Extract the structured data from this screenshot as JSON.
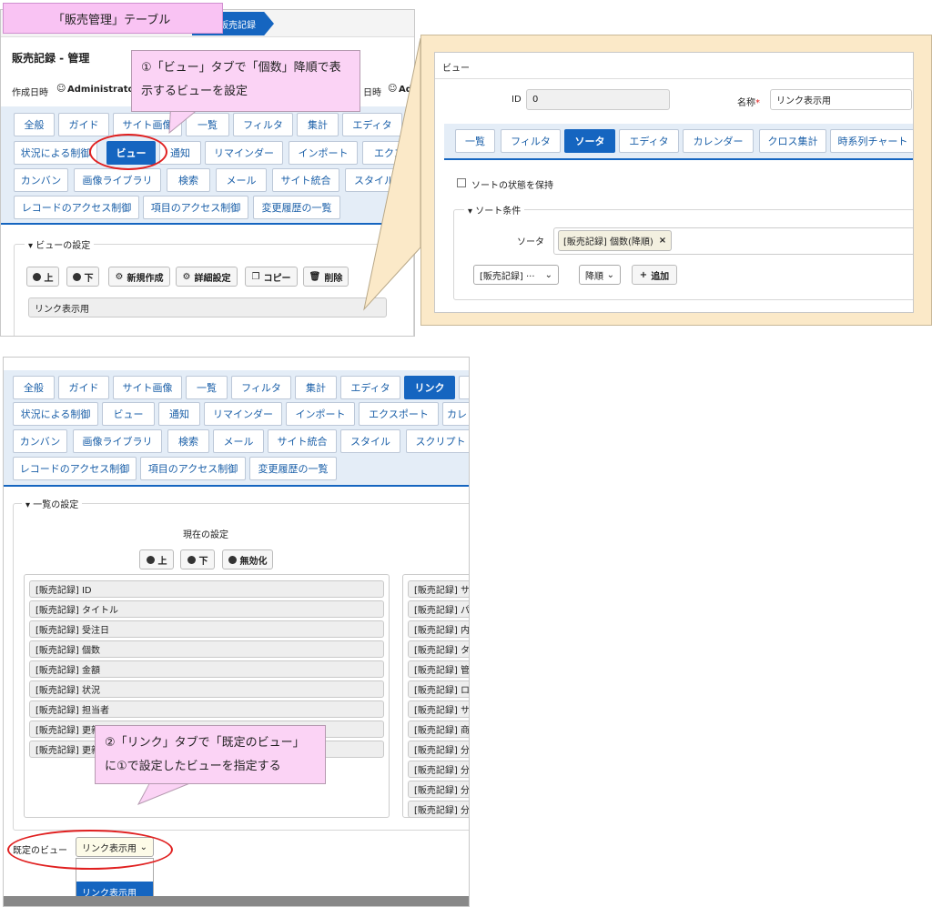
{
  "top_left": {
    "title_label": "「販売管理」テーブル",
    "breadcrumb_current": "販売記録",
    "page_title": "販売記録 - 管理",
    "created_label": "作成日時",
    "created_user": "Administrato",
    "updated_label": "日時",
    "updated_user": "Adı",
    "tabs": [
      "全般",
      "ガイド",
      "サイト画像",
      "一覧",
      "フィルタ",
      "集計",
      "エディタ",
      "状況による制御",
      "ビュー",
      "通知",
      "リマインダー",
      "インポート",
      "エクスポー",
      "カンバン",
      "画像ライブラリ",
      "検索",
      "メール",
      "サイト統合",
      "スタイル",
      "レコードのアクセス制御",
      "項目のアクセス制御",
      "変更履歴の一覧"
    ],
    "view_settings_legend": "ビューの設定",
    "buttons": [
      "上",
      "下",
      "新規作成",
      "詳細設定",
      "コピー",
      "削除"
    ],
    "view_item": "リンク表示用",
    "callout": "①「ビュー」タブで「個数」降順で表示するビューを設定"
  },
  "view_dialog": {
    "title": "ビュー",
    "id_label": "ID",
    "id_value": "0",
    "name_label": "名称",
    "required_mark": "*",
    "name_value": "リンク表示用",
    "tabs": [
      "一覧",
      "フィルタ",
      "ソータ",
      "エディタ",
      "カレンダー",
      "クロス集計",
      "時系列チャート"
    ],
    "keep_sort_label": "ソートの状態を保持",
    "sort_legend": "ソート条件",
    "sorter_label": "ソータ",
    "sorter_chip": "[販売記録] 個数(降順)",
    "chip_remove": "×",
    "column_select": "[販売記録] ···",
    "order_select": "降順",
    "add_button": "追加"
  },
  "bottom": {
    "tabs": [
      "全般",
      "ガイド",
      "サイト画像",
      "一覧",
      "フィルタ",
      "集計",
      "エディタ",
      "リンク",
      "状況による制御",
      "ビュー",
      "通知",
      "リマインダー",
      "インポート",
      "エクスポート",
      "カレ",
      "カンバン",
      "画像ライブラリ",
      "検索",
      "メール",
      "サイト統合",
      "スタイル",
      "スクリプト",
      "レコードのアクセス制御",
      "項目のアクセス制御",
      "変更履歴の一覧"
    ],
    "list_legend": "一覧の設定",
    "current_setting": "現在の設定",
    "buttons": [
      "上",
      "下",
      "無効化"
    ],
    "left_items": [
      "[販売記録] ID",
      "[販売記録] タイトル",
      "[販売記録] 受注日",
      "[販売記録] 個数",
      "[販売記録] 金額",
      "[販売記録] 状況",
      "[販売記録] 担当者",
      "[販売記録] 更新",
      "[販売記録] 更新"
    ],
    "right_items": [
      "[販売記録] サ",
      "[販売記録] パ",
      "[販売記録] 内",
      "[販売記録] タ",
      "[販売記録] 管",
      "[販売記録] ロ",
      "[販売記録] サ",
      "[販売記録] 商",
      "[販売記録] 分",
      "[販売記録] 分",
      "[販売記録] 分",
      "[販売記録] 分"
    ],
    "default_view_label": "既定のビュー",
    "default_view_value": "リンク表示用",
    "dropdown_option": "リンク表示用",
    "callout": "②「リンク」タブで「既定のビュー」に①で設定したビューを指定する"
  }
}
